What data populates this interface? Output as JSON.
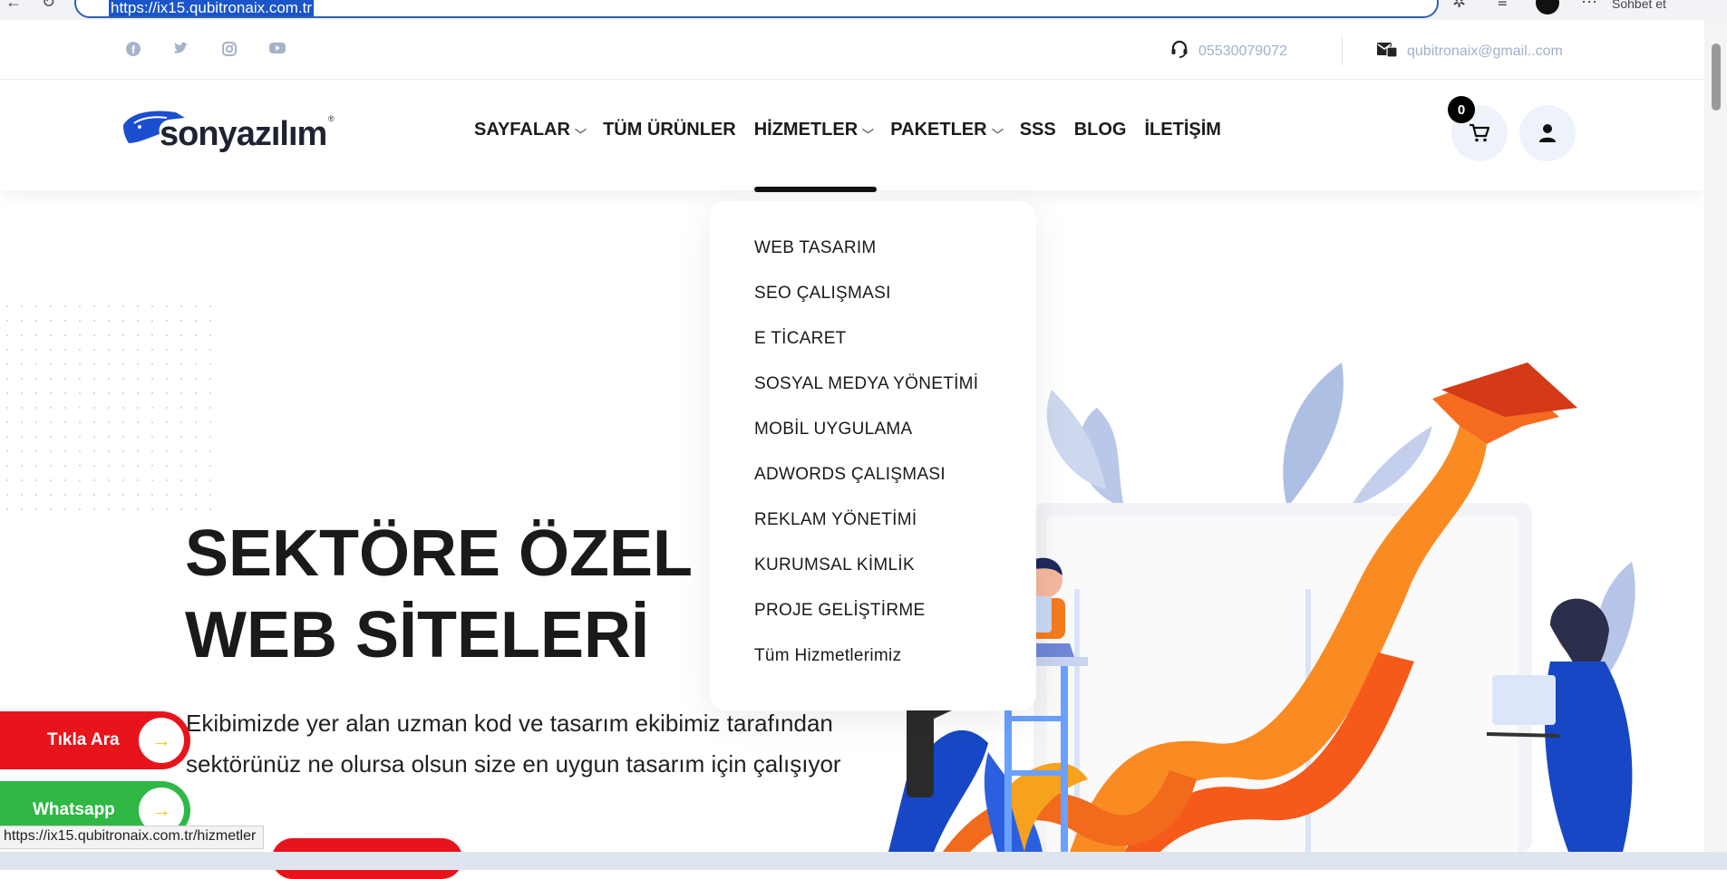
{
  "browser": {
    "url": "https://ix15.qubitronaix.com.tr",
    "tab_label": "Sohbet et"
  },
  "topbar": {
    "social": [
      "facebook-icon",
      "twitter-icon",
      "instagram-icon",
      "youtube-icon"
    ],
    "phone": "05530079072",
    "email": "qubitronaix@gmail..com"
  },
  "header": {
    "brand": "sonyazılım",
    "nav": [
      {
        "label": "SAYFALAR",
        "has_dropdown": true
      },
      {
        "label": "TÜM ÜRÜNLER",
        "has_dropdown": false
      },
      {
        "label": "HİZMETLER",
        "has_dropdown": true
      },
      {
        "label": "PAKETLER",
        "has_dropdown": true
      },
      {
        "label": "SSS",
        "has_dropdown": false
      },
      {
        "label": "BLOG",
        "has_dropdown": false
      },
      {
        "label": "İLETİŞİM",
        "has_dropdown": false
      }
    ],
    "cart_count": "0"
  },
  "dropdown": {
    "items": [
      "WEB TASARIM",
      "SEO ÇALIŞMASI",
      "E TİCARET",
      "SOSYAL MEDYA YÖNETİMİ",
      "MOBİL UYGULAMA",
      "ADWORDS ÇALIŞMASI",
      "REKLAM YÖNETİMİ",
      "KURUMSAL KİMLİK",
      "PROJE GELİŞTİRME",
      "Tüm Hizmetlerimiz"
    ]
  },
  "hero": {
    "title_line1": "SEKTÖRE ÖZEL",
    "title_line2": "WEB SİTELERİ",
    "desc_line1": "Ekibimizde yer alan uzman kod ve tasarım ekibimiz tarafından",
    "desc_line2": "sektörünüz ne olursa olsun size en uygun tasarım için çalışıyor"
  },
  "floating": {
    "call_label": "Tıkla Ara",
    "whatsapp_label": "Whatsapp",
    "call_color": "#e8141b",
    "whatsapp_color": "#2fb846"
  },
  "status_tip": "https://ix15.qubitronaix.com.tr/hizmetler"
}
